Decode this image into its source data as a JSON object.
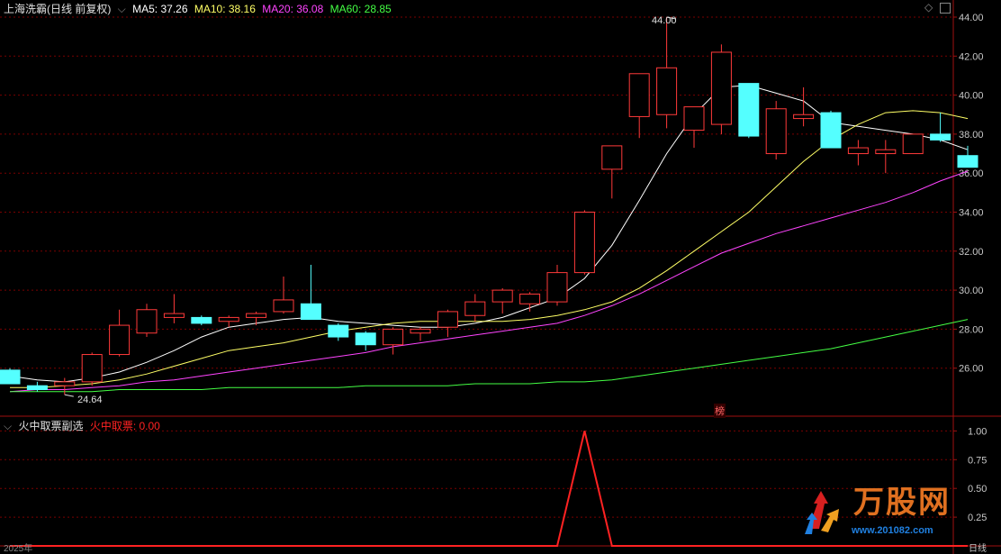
{
  "header": {
    "title": "上海洗霸(日线 前复权)",
    "ma": [
      {
        "label": "MA5: 37.26",
        "color": "#ffffff"
      },
      {
        "label": "MA10: 38.16",
        "color": "#ffff66"
      },
      {
        "label": "MA20: 36.08",
        "color": "#ff44ff"
      },
      {
        "label": "MA60: 28.85",
        "color": "#44ff44"
      }
    ]
  },
  "subpanel": {
    "title": "火中取票副选",
    "indicator_label": "火中取票: 0.00",
    "indicator_color": "#ff2222"
  },
  "annotations": {
    "high": "44.00",
    "low": "24.64",
    "badge": "榜"
  },
  "footer": {
    "left": "2025年",
    "right": "日线"
  },
  "watermark": {
    "brand": "万股网",
    "url": "www.201082.com"
  },
  "colors": {
    "up": "#ff3a3a",
    "down": "#54ffff",
    "grid": "#7a0000",
    "axis": "#a01010"
  },
  "chart_data": [
    {
      "type": "candlestick",
      "ylim": [
        24,
        44
      ],
      "yticks": [
        "44.00",
        "42.00",
        "40.00",
        "38.00",
        "36.00",
        "34.00",
        "32.00",
        "30.00",
        "28.00",
        "26.00"
      ],
      "candles": [
        {
          "o": 25.9,
          "h": 26.0,
          "l": 25.2,
          "c": 25.2
        },
        {
          "o": 25.1,
          "h": 25.3,
          "l": 24.8,
          "c": 24.9
        },
        {
          "o": 25.1,
          "h": 25.5,
          "l": 24.64,
          "c": 25.3
        },
        {
          "o": 25.3,
          "h": 26.8,
          "l": 25.1,
          "c": 26.7
        },
        {
          "o": 26.7,
          "h": 29.0,
          "l": 26.6,
          "c": 28.2
        },
        {
          "o": 27.8,
          "h": 29.3,
          "l": 27.6,
          "c": 29.0
        },
        {
          "o": 28.6,
          "h": 29.8,
          "l": 28.3,
          "c": 28.8
        },
        {
          "o": 28.6,
          "h": 28.7,
          "l": 28.2,
          "c": 28.3
        },
        {
          "o": 28.4,
          "h": 28.7,
          "l": 28.1,
          "c": 28.6
        },
        {
          "o": 28.6,
          "h": 28.9,
          "l": 28.2,
          "c": 28.8
        },
        {
          "o": 28.9,
          "h": 30.7,
          "l": 28.8,
          "c": 29.5
        },
        {
          "o": 29.3,
          "h": 31.3,
          "l": 28.5,
          "c": 28.5
        },
        {
          "o": 28.2,
          "h": 28.3,
          "l": 27.4,
          "c": 27.6
        },
        {
          "o": 27.8,
          "h": 27.9,
          "l": 26.9,
          "c": 27.2
        },
        {
          "o": 27.2,
          "h": 28.1,
          "l": 26.7,
          "c": 28.0
        },
        {
          "o": 27.8,
          "h": 28.1,
          "l": 27.4,
          "c": 28.0
        },
        {
          "o": 28.1,
          "h": 29.0,
          "l": 27.6,
          "c": 28.9
        },
        {
          "o": 28.7,
          "h": 29.8,
          "l": 28.4,
          "c": 29.4
        },
        {
          "o": 29.4,
          "h": 30.1,
          "l": 28.8,
          "c": 30.0
        },
        {
          "o": 29.3,
          "h": 29.9,
          "l": 28.9,
          "c": 29.8
        },
        {
          "o": 29.4,
          "h": 31.3,
          "l": 29.2,
          "c": 30.9
        },
        {
          "o": 30.9,
          "h": 34.1,
          "l": 30.8,
          "c": 34.0
        },
        {
          "o": 36.2,
          "h": 37.4,
          "l": 34.7,
          "c": 37.4
        },
        {
          "o": 38.9,
          "h": 41.0,
          "l": 37.8,
          "c": 41.1
        },
        {
          "o": 39.0,
          "h": 44.0,
          "l": 38.3,
          "c": 41.4
        },
        {
          "o": 38.2,
          "h": 39.3,
          "l": 37.3,
          "c": 39.4
        },
        {
          "o": 38.5,
          "h": 42.6,
          "l": 38.0,
          "c": 42.2
        },
        {
          "o": 40.6,
          "h": 40.6,
          "l": 37.8,
          "c": 37.9
        },
        {
          "o": 37.0,
          "h": 39.7,
          "l": 36.7,
          "c": 39.3
        },
        {
          "o": 38.8,
          "h": 40.4,
          "l": 38.4,
          "c": 39.0
        },
        {
          "o": 39.1,
          "h": 39.2,
          "l": 37.3,
          "c": 37.3
        },
        {
          "o": 37.0,
          "h": 37.7,
          "l": 36.4,
          "c": 37.3
        },
        {
          "o": 37.0,
          "h": 37.7,
          "l": 36.0,
          "c": 37.2
        },
        {
          "o": 37.0,
          "h": 38.0,
          "l": 37.0,
          "c": 38.0
        },
        {
          "o": 38.0,
          "h": 39.1,
          "l": 37.6,
          "c": 37.7
        },
        {
          "o": 36.9,
          "h": 37.4,
          "l": 36.3,
          "c": 36.3
        }
      ],
      "series": [
        {
          "name": "MA5",
          "color": "#ffffff",
          "values": [
            25.6,
            25.4,
            25.3,
            25.5,
            25.8,
            26.3,
            26.9,
            27.6,
            28.1,
            28.3,
            28.5,
            28.6,
            28.4,
            28.3,
            28.2,
            28.1,
            28.1,
            28.3,
            28.6,
            29.1,
            29.6,
            30.6,
            32.3,
            34.6,
            37.0,
            39.0,
            40.4,
            40.5,
            40.1,
            39.7,
            38.6,
            38.4,
            38.2,
            38.0,
            37.7,
            37.2
          ]
        },
        {
          "name": "MA10",
          "color": "#ffff66",
          "values": [
            25.0,
            25.0,
            25.1,
            25.2,
            25.4,
            25.7,
            26.1,
            26.5,
            26.9,
            27.1,
            27.3,
            27.6,
            27.9,
            28.1,
            28.3,
            28.4,
            28.4,
            28.4,
            28.4,
            28.5,
            28.7,
            29.0,
            29.4,
            30.1,
            31.0,
            32.0,
            33.0,
            34.0,
            35.3,
            36.6,
            37.7,
            38.5,
            39.1,
            39.2,
            39.1,
            38.8
          ]
        },
        {
          "name": "MA20",
          "color": "#ff44ff",
          "values": [
            24.8,
            24.9,
            24.9,
            25.0,
            25.1,
            25.3,
            25.4,
            25.6,
            25.8,
            26.0,
            26.2,
            26.4,
            26.6,
            26.8,
            27.1,
            27.3,
            27.5,
            27.7,
            27.9,
            28.1,
            28.3,
            28.7,
            29.2,
            29.8,
            30.5,
            31.2,
            31.9,
            32.4,
            32.9,
            33.3,
            33.7,
            34.1,
            34.5,
            35.0,
            35.6,
            36.1
          ]
        },
        {
          "name": "MA60",
          "color": "#44ff44",
          "values": [
            24.8,
            24.8,
            24.8,
            24.8,
            24.9,
            24.9,
            24.9,
            24.9,
            25.0,
            25.0,
            25.0,
            25.0,
            25.0,
            25.1,
            25.1,
            25.1,
            25.1,
            25.2,
            25.2,
            25.2,
            25.3,
            25.3,
            25.4,
            25.6,
            25.8,
            26.0,
            26.2,
            26.4,
            26.6,
            26.8,
            27.0,
            27.3,
            27.6,
            27.9,
            28.2,
            28.5
          ]
        }
      ]
    },
    {
      "type": "line",
      "ylim": [
        0,
        1.05
      ],
      "yticks": [
        "1.00",
        "0.75",
        "0.50",
        "0.25"
      ],
      "series": [
        {
          "name": "火中取票",
          "color": "#ff2222",
          "values": [
            0,
            0,
            0,
            0,
            0,
            0,
            0,
            0,
            0,
            0,
            0,
            0,
            0,
            0,
            0,
            0,
            0,
            0,
            0,
            0,
            0,
            1,
            0,
            0,
            0,
            0,
            0,
            0,
            0,
            0,
            0,
            0,
            0,
            0,
            0,
            0
          ]
        }
      ]
    }
  ]
}
